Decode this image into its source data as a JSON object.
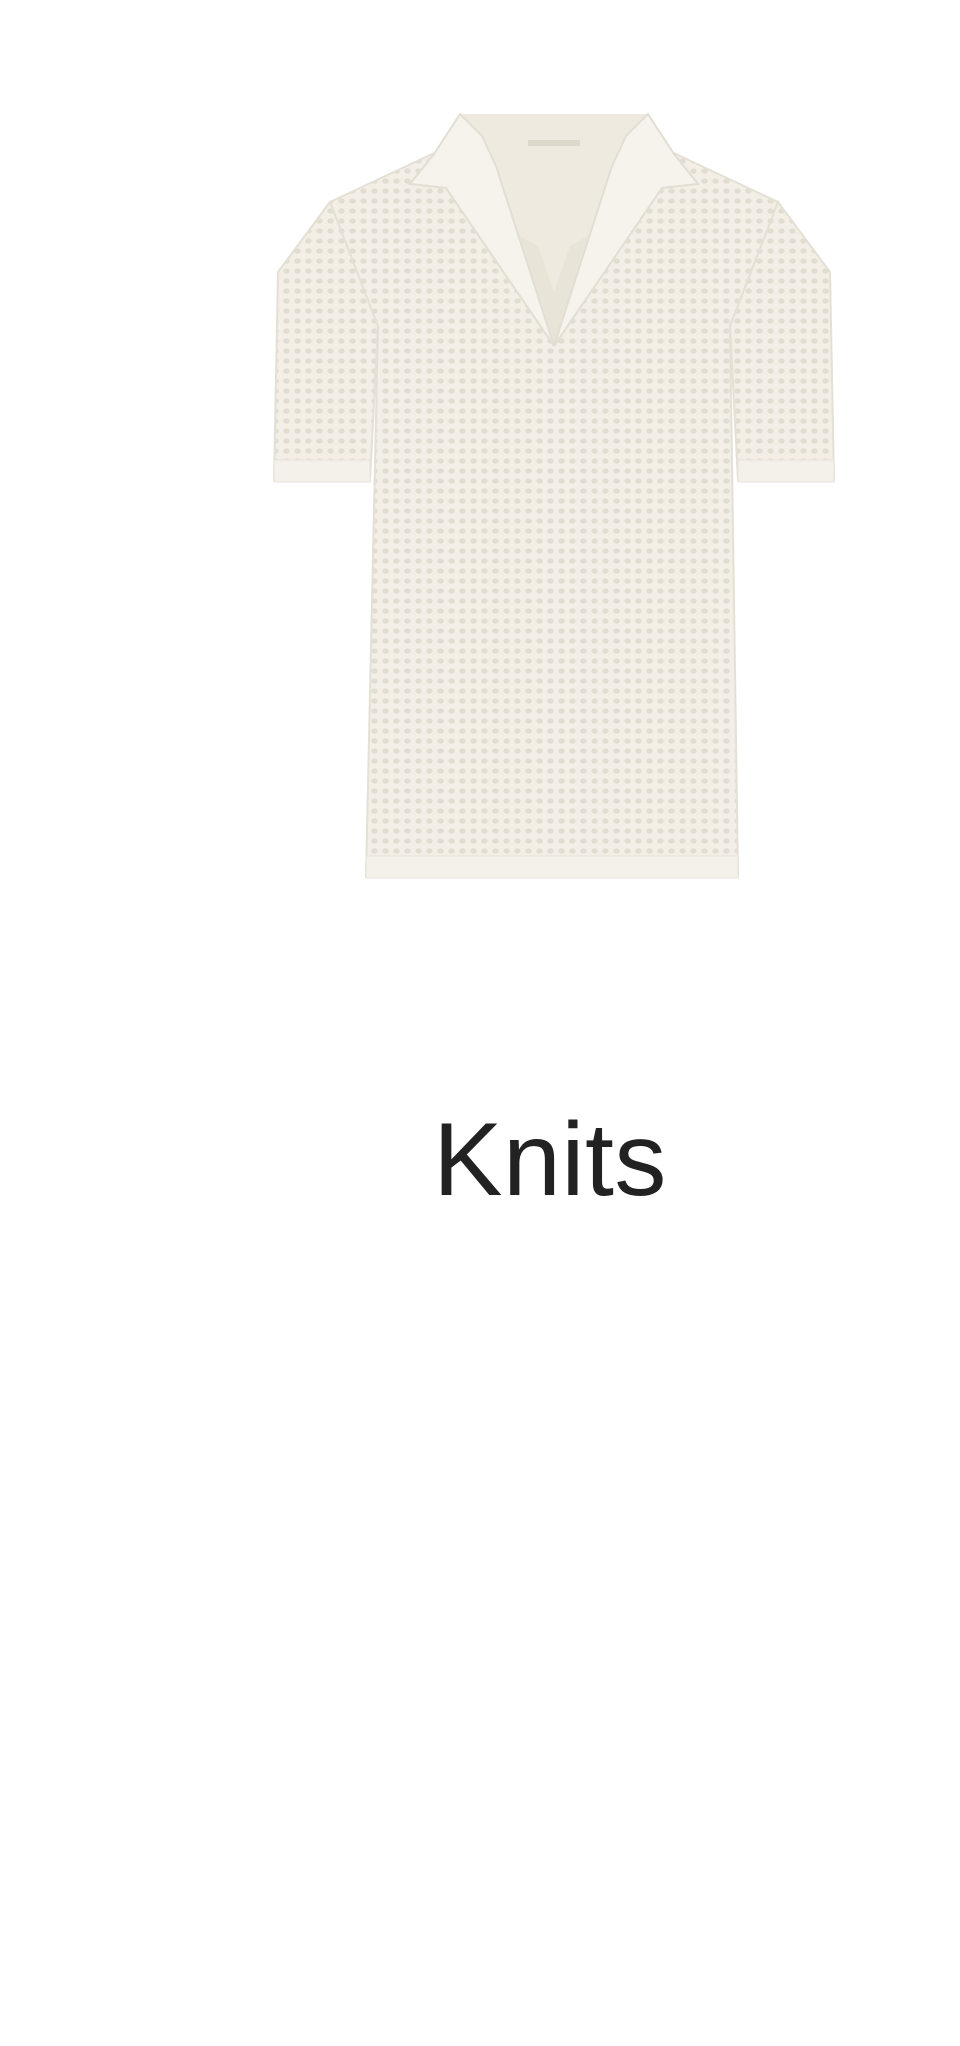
{
  "category": {
    "label": "Knits",
    "image_icon": "knit-polo-shirt-icon",
    "garment_color": "#f1ede3",
    "text_color": "#222222"
  }
}
